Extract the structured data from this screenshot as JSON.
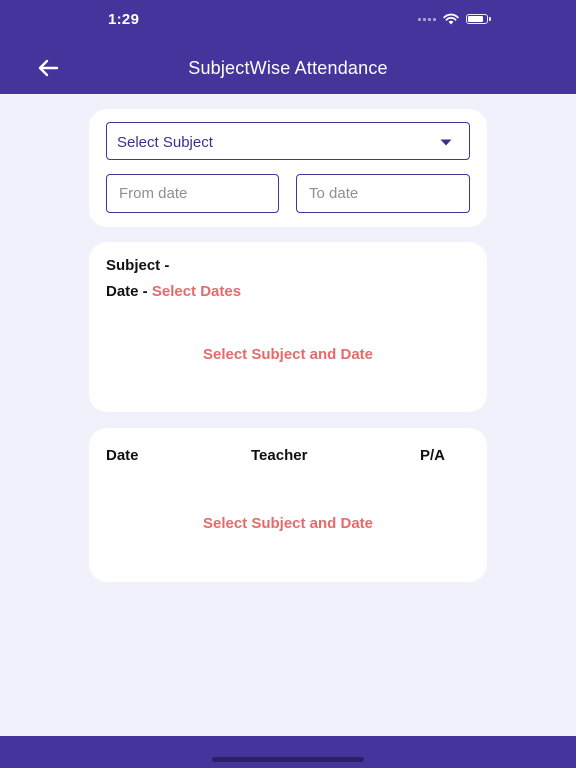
{
  "status_bar": {
    "time": "1:29"
  },
  "nav": {
    "title": "SubjectWise Attendance",
    "back_icon": "arrow-left-icon"
  },
  "filter": {
    "subject_select": {
      "value": "Select Subject"
    },
    "from_date": {
      "placeholder": "From date",
      "value": ""
    },
    "to_date": {
      "placeholder": "To date",
      "value": ""
    }
  },
  "info": {
    "subject_label": "Subject -",
    "date_label": "Date -",
    "date_value": "Select Dates",
    "message": "Select Subject and Date"
  },
  "table": {
    "columns": [
      "Date",
      "Teacher",
      "P/A"
    ],
    "message": "Select Subject and Date"
  },
  "colors": {
    "primary": "#44349c",
    "accent": "#e56b6b",
    "background": "#f0f1fa"
  }
}
